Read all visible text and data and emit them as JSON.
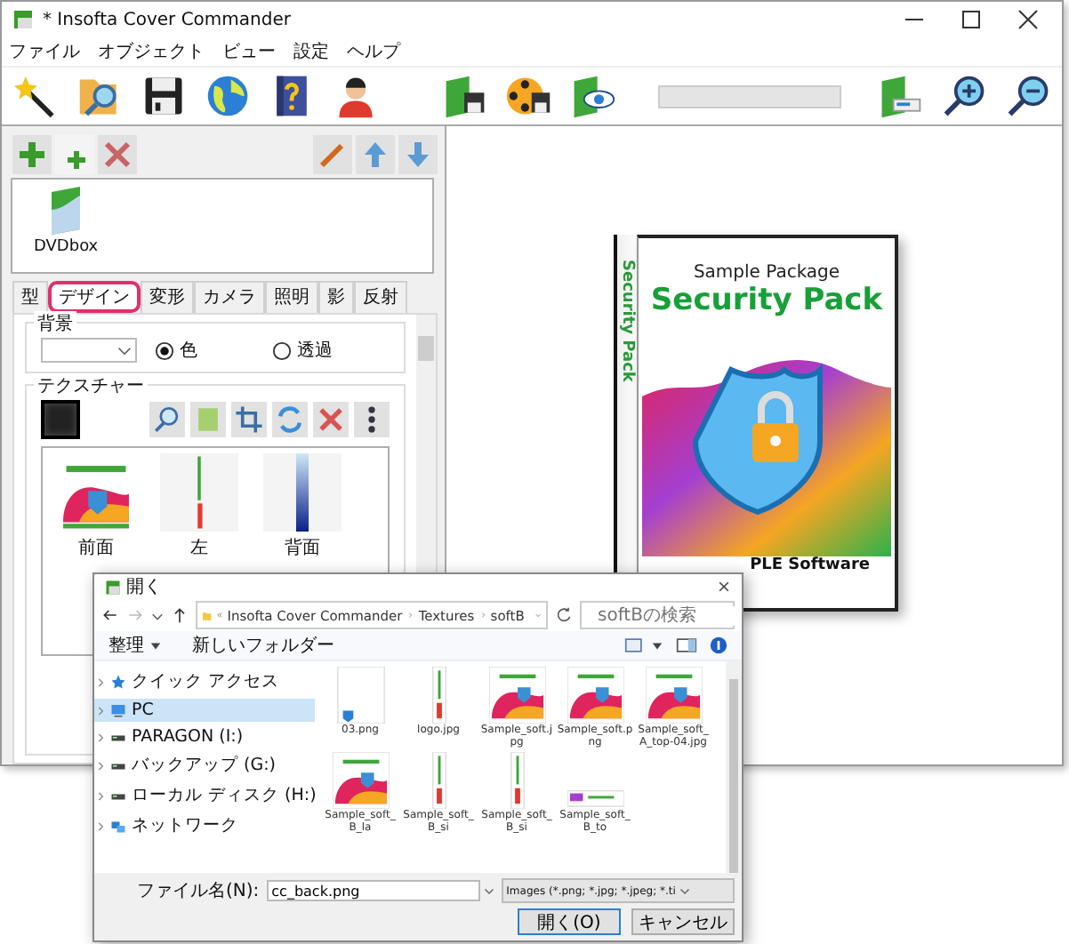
{
  "window": {
    "title": "* Insofta Cover Commander"
  },
  "menu": [
    "ファイル",
    "オブジェクト",
    "ビュー",
    "設定",
    "ヘルプ"
  ],
  "objects": [
    {
      "label": "DVDbox"
    }
  ],
  "tabs": [
    {
      "label": "型",
      "selected": false
    },
    {
      "label": "デザイン",
      "selected": true
    },
    {
      "label": "変形",
      "selected": false
    },
    {
      "label": "カメラ",
      "selected": false
    },
    {
      "label": "照明",
      "selected": false
    },
    {
      "label": "影",
      "selected": false
    },
    {
      "label": "反射",
      "selected": false
    }
  ],
  "background": {
    "title": "背景",
    "options": [
      {
        "label": "色",
        "selected": true
      },
      {
        "label": "透過",
        "selected": false
      }
    ]
  },
  "texture": {
    "title": "テクスチャー",
    "items": [
      {
        "label": "前面",
        "kind": "cover"
      },
      {
        "label": "左",
        "kind": "spine"
      },
      {
        "label": "背面",
        "kind": "gradient"
      }
    ]
  },
  "preview": {
    "spine": "Security Pack",
    "subtitle": "Sample Package",
    "title": "Security Pack",
    "publisher": "PLE Software"
  },
  "dialog": {
    "title": "開く",
    "path": [
      "Insofta Cover Commander",
      "Textures",
      "softB"
    ],
    "search_placeholder": "softBの検索",
    "organize": "整理",
    "new_folder": "新しいフォルダー",
    "nav": [
      {
        "label": "クイック アクセス",
        "kind": "star",
        "selected": false
      },
      {
        "label": "PC",
        "kind": "pc",
        "selected": true
      },
      {
        "label": "PARAGON (I:)",
        "kind": "drive",
        "selected": false
      },
      {
        "label": "バックアップ (G:)",
        "kind": "drive",
        "selected": false
      },
      {
        "label": "ローカル ディスク (H:)",
        "kind": "drive",
        "selected": false
      },
      {
        "label": "ネットワーク",
        "kind": "network",
        "selected": false
      }
    ],
    "files": [
      {
        "name": "03.png",
        "kind": "small"
      },
      {
        "name": "logo.jpg",
        "kind": "spine"
      },
      {
        "name": "Sample_soft.jpg",
        "kind": "cover"
      },
      {
        "name": "Sample_soft.png",
        "kind": "cover"
      },
      {
        "name": "Sample_soft_A_top-04.jpg",
        "kind": "square"
      },
      {
        "name": "Sample_soft_B_la",
        "kind": "cover"
      },
      {
        "name": "Sample_soft_B_si",
        "kind": "spine"
      },
      {
        "name": "Sample_soft_B_si",
        "kind": "spine"
      },
      {
        "name": "Sample_soft_B_to",
        "kind": "banner"
      }
    ],
    "filename_label": "ファイル名(N):",
    "filename": "cc_back.png",
    "filter": "Images (*.png; *.jpg; *.jpeg; *.ti",
    "buttons": [
      "開く(O)",
      "キャンセル"
    ]
  }
}
